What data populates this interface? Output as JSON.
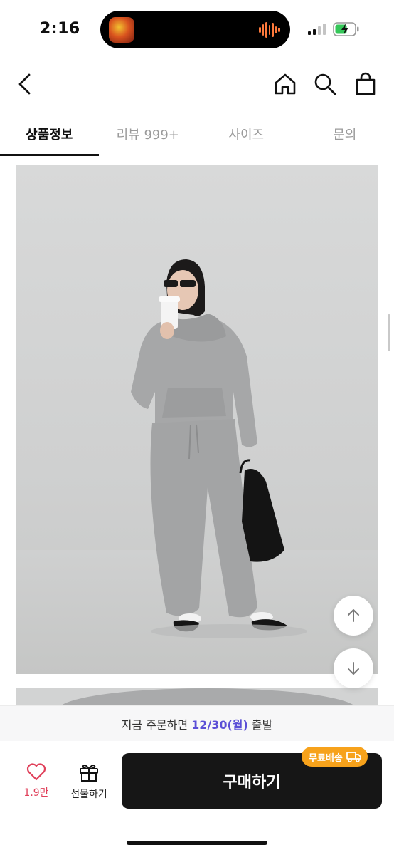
{
  "status_bar": {
    "time": "2:16"
  },
  "tabs": [
    {
      "label": "상품정보",
      "active": true
    },
    {
      "label": "리뷰 999+",
      "active": false
    },
    {
      "label": "사이즈",
      "active": false
    },
    {
      "label": "문의",
      "active": false
    }
  ],
  "icons": {
    "back": "chevron-left-icon",
    "home": "home-icon",
    "search": "search-icon",
    "cart": "shopping-bag-icon",
    "scroll_up": "arrow-up-icon",
    "scroll_down": "arrow-down-icon",
    "like": "heart-icon",
    "gift": "gift-icon",
    "truck": "truck-icon"
  },
  "delivery": {
    "prefix": "지금 주문하면",
    "date": "12/30(월)",
    "suffix": "출발"
  },
  "bottom_bar": {
    "like_count": "1.9만",
    "gift_label": "선물하기",
    "buy_label": "구매하기",
    "free_shipping_badge": "무료배송"
  },
  "colors": {
    "accent_date": "#5b4fd6",
    "like": "#e0405a",
    "badge": "#f7a21b",
    "buy_button": "#161616"
  }
}
